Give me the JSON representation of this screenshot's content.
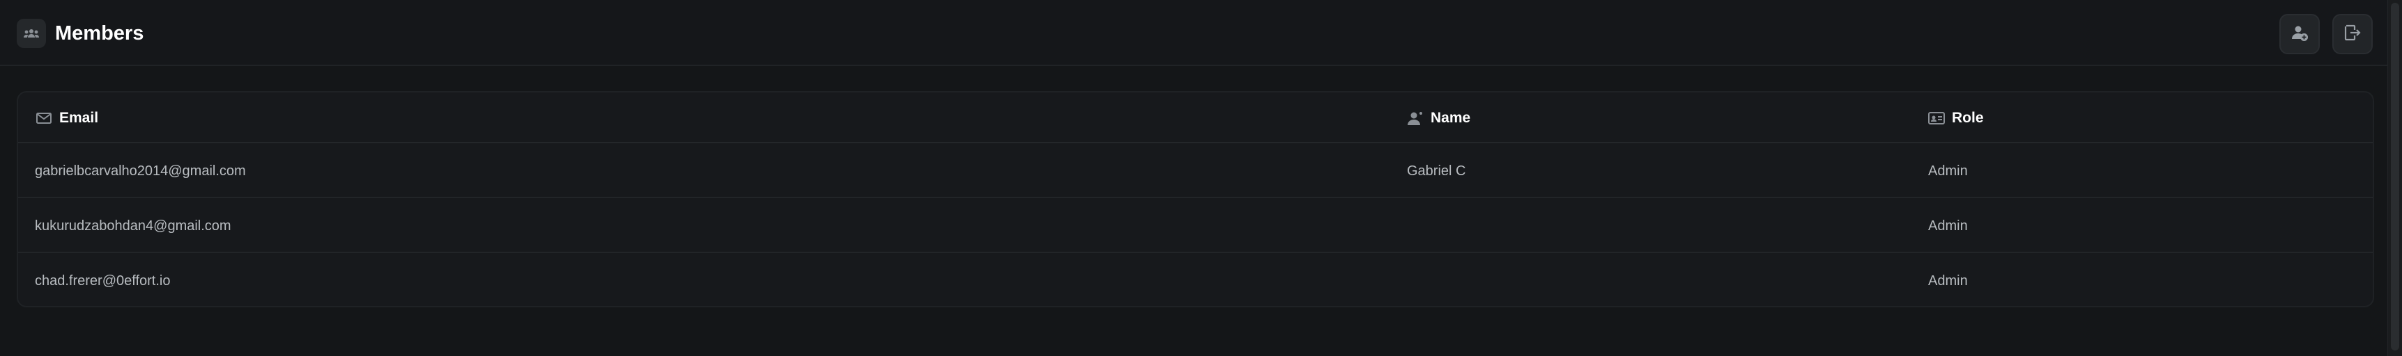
{
  "header": {
    "title": "Members",
    "icon": "users-group-icon",
    "actions": [
      {
        "name": "add-member-button",
        "icon": "user-plus-icon"
      },
      {
        "name": "leave-button",
        "icon": "exit-icon"
      }
    ]
  },
  "table": {
    "columns": [
      {
        "label": "Email",
        "icon": "envelope-icon"
      },
      {
        "label": "Name",
        "icon": "user-icon"
      },
      {
        "label": "Role",
        "icon": "id-card-icon"
      }
    ],
    "rows": [
      {
        "email": "gabrielbcarvalho2014@gmail.com",
        "name": "Gabriel C",
        "role": "Admin"
      },
      {
        "email": "kukurudzabohdan4@gmail.com",
        "name": "",
        "role": "Admin"
      },
      {
        "email": "chad.frerer@0effort.io",
        "name": "",
        "role": "Admin"
      }
    ]
  },
  "colors": {
    "background": "#141618",
    "panel": "#17191c",
    "border": "#24272a",
    "text_primary": "#ffffff",
    "text_secondary": "#b8bcc0",
    "icon_muted": "#8a8f95"
  }
}
